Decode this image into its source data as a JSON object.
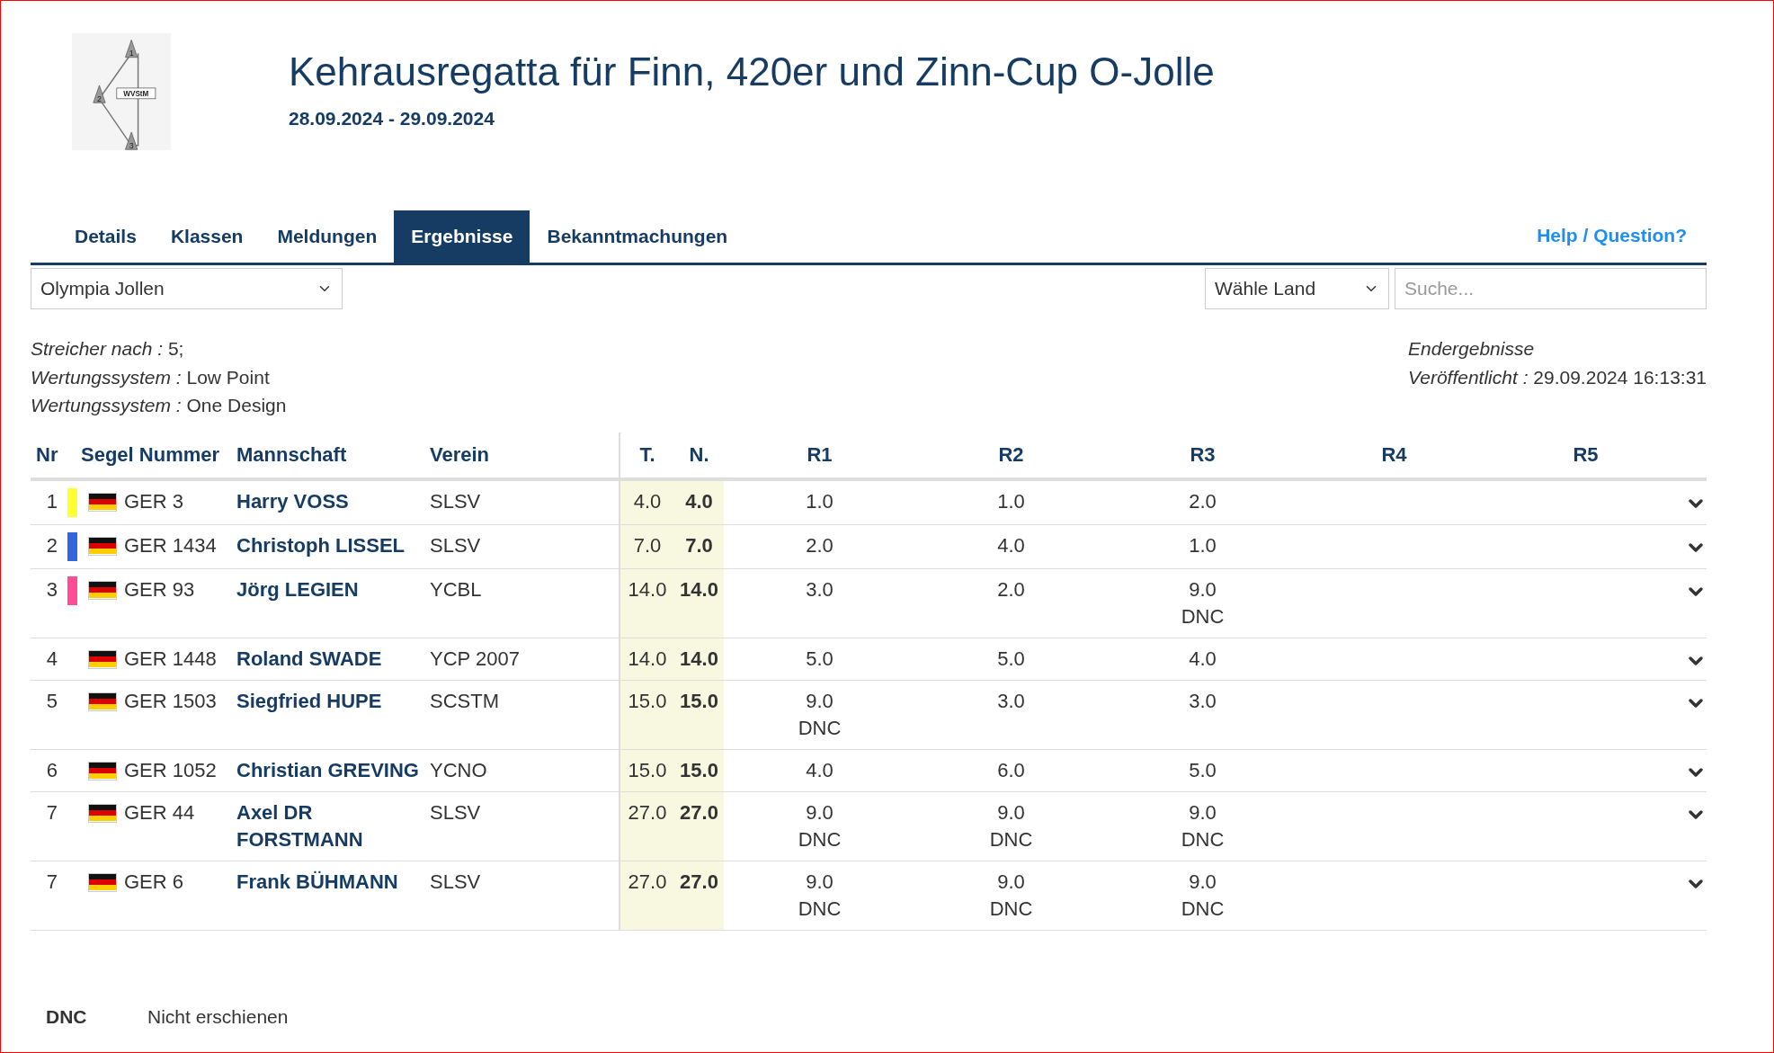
{
  "logo": {
    "label": "WVStM",
    "marks": [
      "1",
      "2",
      "3"
    ]
  },
  "header": {
    "title": "Kehrausregatta für Finn, 420er und Zinn-Cup O-Jolle",
    "dates": "28.09.2024 - 29.09.2024"
  },
  "tabs": [
    {
      "label": "Details",
      "selected": false
    },
    {
      "label": "Klassen",
      "selected": false
    },
    {
      "label": "Meldungen",
      "selected": false
    },
    {
      "label": "Ergebnisse",
      "selected": true
    },
    {
      "label": "Bekanntmachungen",
      "selected": false
    }
  ],
  "help_link": "Help / Question?",
  "filters": {
    "class_select": "Olympia Jollen",
    "country_select": "Wähle Land",
    "search": {
      "placeholder": "Suche..."
    }
  },
  "info_left": [
    "*Streicher nach :* 5;",
    "*Wertungssystem :* Low Point",
    "*Wertungssystem :* One Design"
  ],
  "info_right": [
    "*Endergebnisse*",
    "*Veröffentlicht :* 29.09.2024 16:13:31"
  ],
  "table": {
    "columns": {
      "nr": "Nr",
      "sail": "Segel Nummer",
      "crew": "Mannschaft",
      "club": "Verein",
      "total": "T.",
      "net": "N.",
      "races": [
        "R1",
        "R2",
        "R3",
        "R4",
        "R5"
      ]
    },
    "rows": [
      {
        "nr": "1",
        "color": "#ffff33",
        "sail": "GER 3",
        "crew": "Harry VOSS",
        "club": "SLSV",
        "total": "4.0",
        "net": "4.0",
        "races": [
          {
            "score": "1.0"
          },
          {
            "score": "1.0"
          },
          {
            "score": "2.0"
          }
        ]
      },
      {
        "nr": "2",
        "color": "#3366dd",
        "sail": "GER 1434",
        "crew": "Christoph LISSEL",
        "club": "SLSV",
        "total": "7.0",
        "net": "7.0",
        "races": [
          {
            "score": "2.0"
          },
          {
            "score": "4.0"
          },
          {
            "score": "1.0"
          }
        ]
      },
      {
        "nr": "3",
        "color": "#ff4d94",
        "sail": "GER 93",
        "crew": "Jörg LEGIEN",
        "club": "YCBL",
        "total": "14.0",
        "net": "14.0",
        "races": [
          {
            "score": "3.0"
          },
          {
            "score": "2.0"
          },
          {
            "score": "9.0",
            "code": "DNC"
          }
        ]
      },
      {
        "nr": "4",
        "sail": "GER 1448",
        "crew": "Roland SWADE",
        "club": "YCP 2007",
        "total": "14.0",
        "net": "14.0",
        "races": [
          {
            "score": "5.0"
          },
          {
            "score": "5.0"
          },
          {
            "score": "4.0"
          }
        ]
      },
      {
        "nr": "5",
        "sail": "GER 1503",
        "crew": "Siegfried HUPE",
        "club": "SCSTM",
        "total": "15.0",
        "net": "15.0",
        "races": [
          {
            "score": "9.0",
            "code": "DNC"
          },
          {
            "score": "3.0"
          },
          {
            "score": "3.0"
          }
        ]
      },
      {
        "nr": "6",
        "sail": "GER 1052",
        "crew": "Christian GREVING",
        "club": "YCNO",
        "total": "15.0",
        "net": "15.0",
        "races": [
          {
            "score": "4.0"
          },
          {
            "score": "6.0"
          },
          {
            "score": "5.0"
          }
        ]
      },
      {
        "nr": "7",
        "sail": "GER 44",
        "crew": "Axel DR FORSTMANN",
        "club": "SLSV",
        "total": "27.0",
        "net": "27.0",
        "races": [
          {
            "score": "9.0",
            "code": "DNC"
          },
          {
            "score": "9.0",
            "code": "DNC"
          },
          {
            "score": "9.0",
            "code": "DNC"
          }
        ]
      },
      {
        "nr": "7",
        "sail": "GER 6",
        "crew": "Frank BÜHMANN",
        "club": "SLSV",
        "total": "27.0",
        "net": "27.0",
        "races": [
          {
            "score": "9.0",
            "code": "DNC"
          },
          {
            "score": "9.0",
            "code": "DNC"
          },
          {
            "score": "9.0",
            "code": "DNC"
          }
        ]
      }
    ]
  },
  "legend": [
    {
      "code": "DNC",
      "meaning": "Nicht erschienen"
    }
  ]
}
